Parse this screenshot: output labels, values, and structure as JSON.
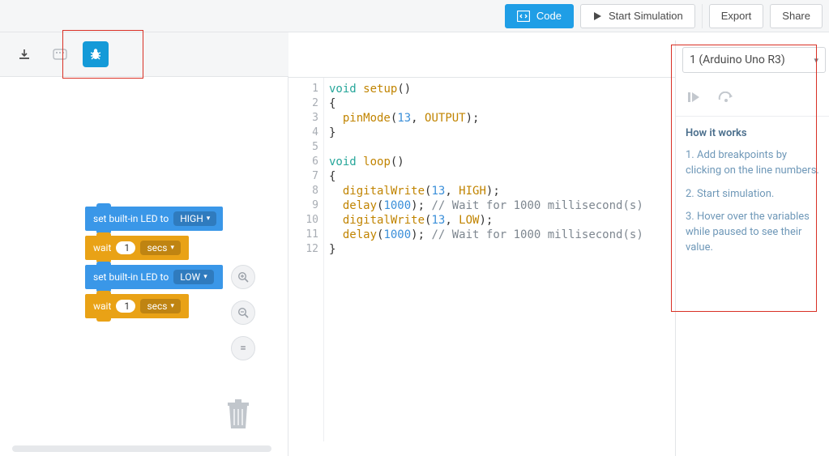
{
  "topbar": {
    "code_label": "Code",
    "sim_label": "Start Simulation",
    "export_label": "Export",
    "share_label": "Share"
  },
  "blocks": {
    "b1": {
      "text": "set built-in LED to",
      "dropdown": "HIGH"
    },
    "b2": {
      "text": "wait",
      "value": "1",
      "unit": "secs"
    },
    "b3": {
      "text": "set built-in LED to",
      "dropdown": "LOW"
    },
    "b4": {
      "text": "wait",
      "value": "1",
      "unit": "secs"
    }
  },
  "editor_lines": [
    "1",
    "2",
    "3",
    "4",
    "5",
    "6",
    "7",
    "8",
    "9",
    "10",
    "11",
    "12"
  ],
  "code": {
    "l1a": "void",
    "l1b": " ",
    "l1c": "setup",
    "l1d": "()",
    "l2": "{",
    "l3a": "  ",
    "l3b": "pinMode",
    "l3c": "(",
    "l3d": "13",
    "l3e": ", ",
    "l3f": "OUTPUT",
    "l3g": ");",
    "l4": "}",
    "l5": "",
    "l6a": "void",
    "l6b": " ",
    "l6c": "loop",
    "l6d": "()",
    "l7": "{",
    "l8a": "  ",
    "l8b": "digitalWrite",
    "l8c": "(",
    "l8d": "13",
    "l8e": ", ",
    "l8f": "HIGH",
    "l8g": ");",
    "l9a": "  ",
    "l9b": "delay",
    "l9c": "(",
    "l9d": "1000",
    "l9e": "); ",
    "l9f": "// Wait for 1000 millisecond(s)",
    "l10a": "  ",
    "l10b": "digitalWrite",
    "l10c": "(",
    "l10d": "13",
    "l10e": ", ",
    "l10f": "LOW",
    "l10g": ");",
    "l11a": "  ",
    "l11b": "delay",
    "l11c": "(",
    "l11d": "1000",
    "l11e": "); ",
    "l11f": "// Wait for 1000 millisecond(s)",
    "l12": "}"
  },
  "right": {
    "device": "1 (Arduino Uno R3)",
    "title": "How it works",
    "step1": "1. Add breakpoints by clicking on the line numbers.",
    "step2": "2. Start simulation.",
    "step3": "3. Hover over the variables while paused to see their value."
  },
  "icons": {
    "download": "download-icon",
    "serial": "serial-icon",
    "bug": "bug-icon",
    "code": "code-window-icon",
    "play": "play-icon",
    "zoom_in": "+",
    "zoom_out": "−",
    "fit": "=",
    "trash": "trash-icon",
    "step_resume": "▶",
    "step_over": "↷",
    "dropdown": "▾"
  }
}
